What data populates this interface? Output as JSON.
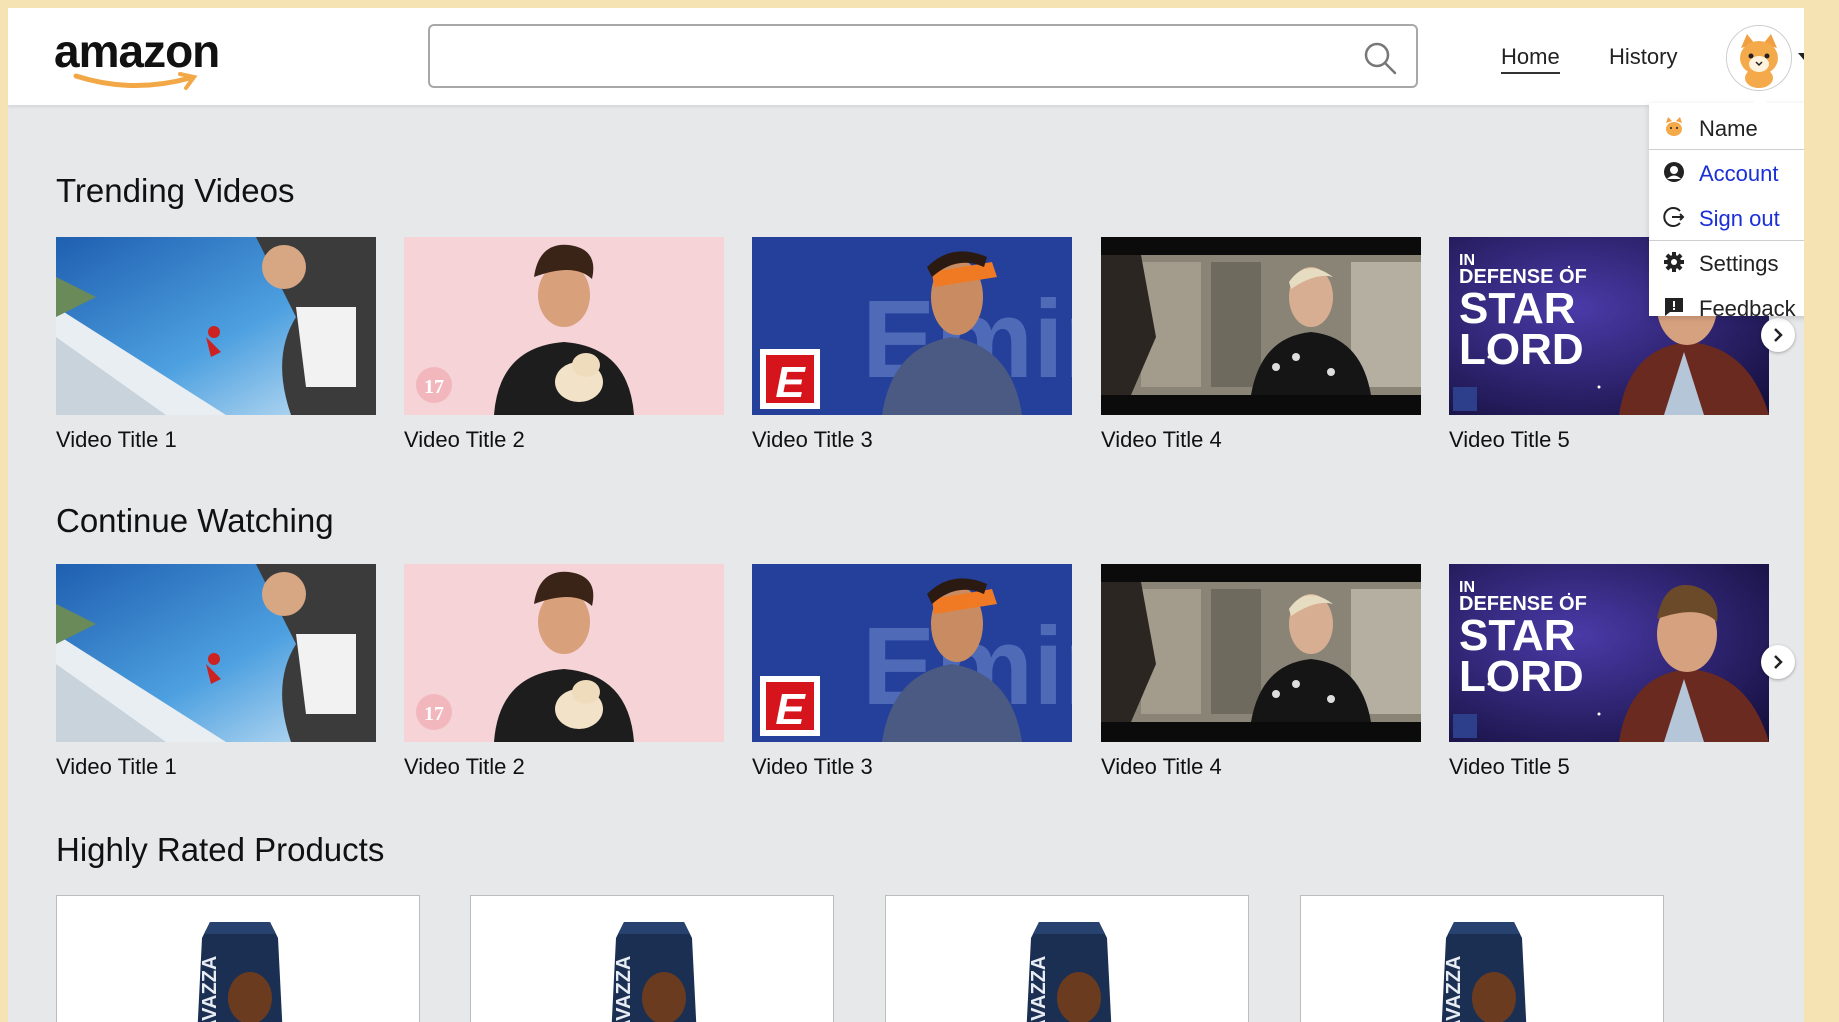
{
  "header": {
    "logo_text": "amazon",
    "search": {
      "value": "",
      "placeholder": ""
    },
    "nav": {
      "home": "Home",
      "history": "History"
    }
  },
  "user_menu": {
    "items": [
      {
        "label": "Name",
        "icon": "cat-face-icon"
      },
      {
        "label": "Account",
        "icon": "user-icon"
      },
      {
        "label": "Sign out",
        "icon": "sign-out-icon"
      },
      {
        "label": "Settings",
        "icon": "gear-icon"
      },
      {
        "label": "Feedback",
        "icon": "feedback-icon"
      }
    ]
  },
  "sections": {
    "trending": {
      "title": "Trending Videos",
      "videos": [
        "Video Title 1",
        "Video Title 2",
        "Video Title 3",
        "Video Title 4",
        "Video Title 5"
      ]
    },
    "continue": {
      "title": "Continue Watching",
      "videos": [
        "Video Title 1",
        "Video Title 2",
        "Video Title 3",
        "Video Title 4",
        "Video Title 5"
      ]
    },
    "products": {
      "title": "Highly Rated Products",
      "count": 4
    }
  },
  "thumb_text": {
    "badge17": "17",
    "espn": "E",
    "starlord_line1": "IN",
    "starlord_line2": "DEFENSE OF",
    "starlord_line3": "STAR",
    "starlord_line4": "LORD",
    "bag_brand": "LAVAZZA"
  },
  "colors": {
    "accent_link": "#1a2fd6",
    "logo_smile": "#f3a847"
  }
}
